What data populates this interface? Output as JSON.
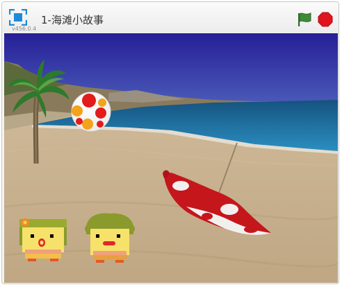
{
  "player": {
    "title": "1-海滩小故事",
    "version": "v456.0.4"
  },
  "controls": {
    "fullscreen_icon": "fullscreen-icon",
    "green_flag_icon": "green-flag-icon",
    "stop_icon": "stop-sign-icon"
  },
  "colors": {
    "accent_blue": "#1f8bd8",
    "flag_green": "#3f8a3a",
    "stop_red": "#e0141e",
    "sky": "#2e2aa0",
    "sea": "#1a7bb3",
    "sand": "#c9b28f"
  },
  "stage": {
    "backdrop": "beach",
    "sprites": [
      "palm-tree",
      "beach-ball",
      "beach-umbrella",
      "girl-character",
      "boy-character"
    ]
  }
}
